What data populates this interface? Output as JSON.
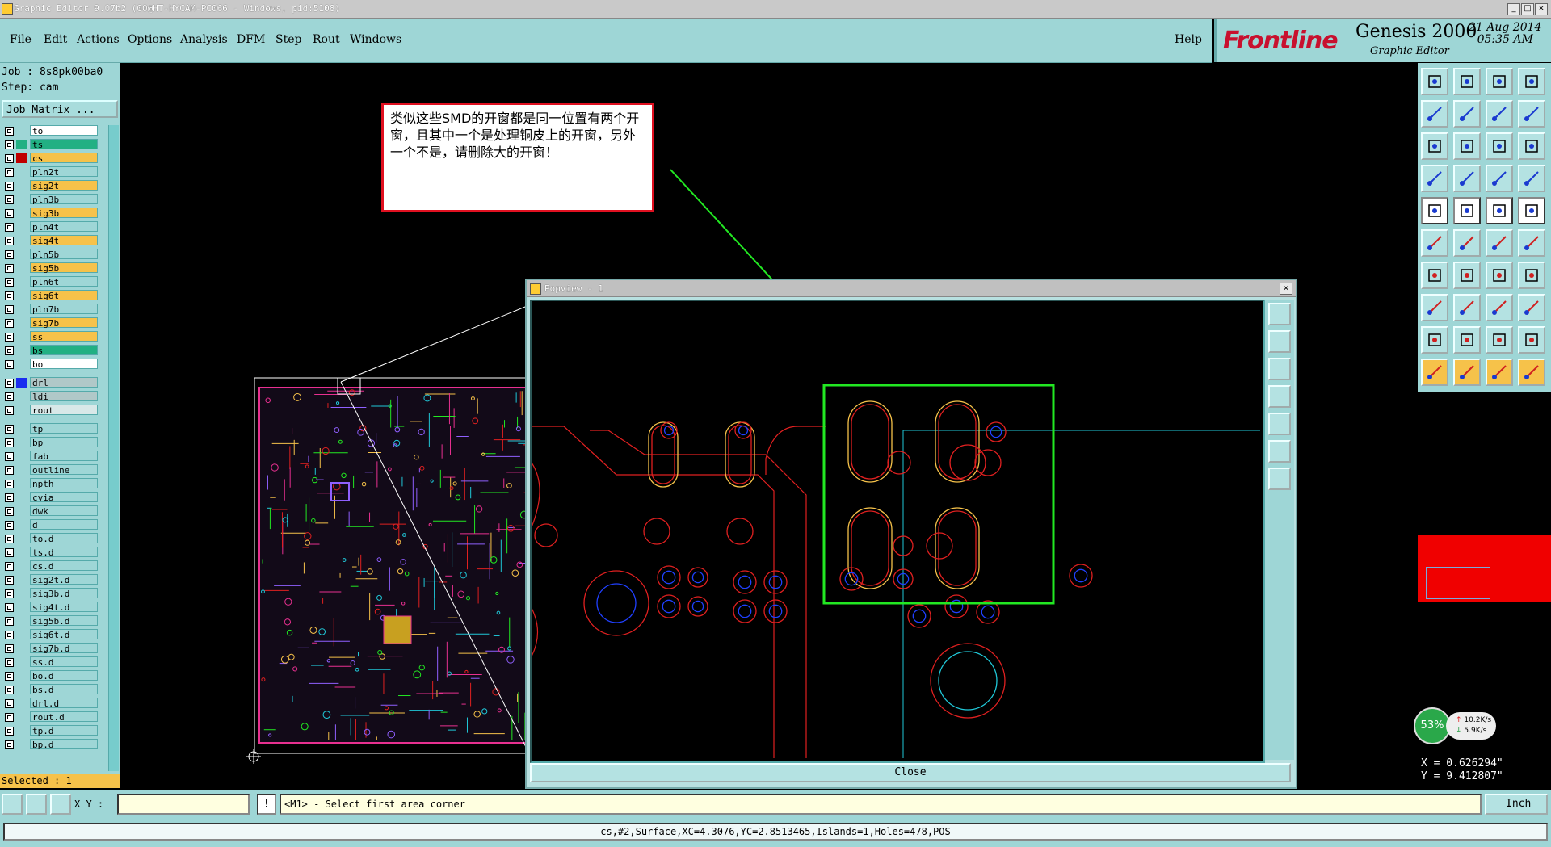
{
  "window": {
    "title": "Graphic Editor 9.07b2 (00@HT-HYCAM-PC066 - Windows, pid:5108)"
  },
  "menu": {
    "items": [
      "File",
      "Edit",
      "Actions",
      "Options",
      "Analysis",
      "DFM",
      "Step",
      "Rout",
      "Windows"
    ],
    "help": "Help"
  },
  "brand": {
    "company": "Frontline",
    "product": "Genesis 2000",
    "subtitle": "Graphic Editor",
    "date": "21 Aug 2014",
    "time": "05:35 AM"
  },
  "job": {
    "job_line": "Job : 8s8pk00ba0",
    "step_line": "Step: cam",
    "matrix_button": "Job Matrix ..."
  },
  "layers": [
    {
      "name": "to",
      "color": "#ffffff",
      "swatch": "#9ed6d6"
    },
    {
      "name": "ts",
      "color": "#22b083",
      "swatch": "#22b083"
    },
    {
      "name": "cs",
      "color": "#f6c24a",
      "swatch": "#c00000"
    },
    {
      "name": "pln2t",
      "color": "#9ed6d6",
      "swatch": "#9ed6d6"
    },
    {
      "name": "sig2t",
      "color": "#f6c24a",
      "swatch": "#9ed6d6"
    },
    {
      "name": "pln3b",
      "color": "#9ed6d6",
      "swatch": "#9ed6d6"
    },
    {
      "name": "sig3b",
      "color": "#f6c24a",
      "swatch": "#9ed6d6"
    },
    {
      "name": "pln4t",
      "color": "#9ed6d6",
      "swatch": "#9ed6d6"
    },
    {
      "name": "sig4t",
      "color": "#f6c24a",
      "swatch": "#9ed6d6"
    },
    {
      "name": "pln5b",
      "color": "#9ed6d6",
      "swatch": "#9ed6d6"
    },
    {
      "name": "sig5b",
      "color": "#f6c24a",
      "swatch": "#9ed6d6"
    },
    {
      "name": "pln6t",
      "color": "#9ed6d6",
      "swatch": "#9ed6d6"
    },
    {
      "name": "sig6t",
      "color": "#f6c24a",
      "swatch": "#9ed6d6"
    },
    {
      "name": "pln7b",
      "color": "#9ed6d6",
      "swatch": "#9ed6d6"
    },
    {
      "name": "sig7b",
      "color": "#f6c24a",
      "swatch": "#9ed6d6"
    },
    {
      "name": "ss",
      "color": "#f6c24a",
      "swatch": "#9ed6d6"
    },
    {
      "name": "bs",
      "color": "#22b083",
      "swatch": "#9ed6d6"
    },
    {
      "name": "bo",
      "color": "#ffffff",
      "swatch": "#9ed6d6"
    },
    {
      "name": "drl",
      "color": "#b0c8c8",
      "swatch": "#1a2cf0"
    },
    {
      "name": "ldi",
      "color": "#b0c8c8",
      "swatch": "#9ed6d6"
    },
    {
      "name": "rout",
      "color": "#d8e8e8",
      "swatch": "#9ed6d6"
    },
    {
      "name": "tp",
      "color": "#9ed6d6",
      "swatch": "#9ed6d6"
    },
    {
      "name": "bp",
      "color": "#9ed6d6",
      "swatch": "#9ed6d6"
    },
    {
      "name": "fab",
      "color": "#9ed6d6",
      "swatch": "#9ed6d6"
    },
    {
      "name": "outline",
      "color": "#9ed6d6",
      "swatch": "#9ed6d6"
    },
    {
      "name": "npth",
      "color": "#9ed6d6",
      "swatch": "#9ed6d6"
    },
    {
      "name": "cvia",
      "color": "#9ed6d6",
      "swatch": "#9ed6d6"
    },
    {
      "name": "dwk",
      "color": "#9ed6d6",
      "swatch": "#9ed6d6"
    },
    {
      "name": "d",
      "color": "#9ed6d6",
      "swatch": "#9ed6d6"
    },
    {
      "name": "to.d",
      "color": "#9ed6d6",
      "swatch": "#9ed6d6"
    },
    {
      "name": "ts.d",
      "color": "#9ed6d6",
      "swatch": "#9ed6d6"
    },
    {
      "name": "cs.d",
      "color": "#9ed6d6",
      "swatch": "#9ed6d6"
    },
    {
      "name": "sig2t.d",
      "color": "#9ed6d6",
      "swatch": "#9ed6d6"
    },
    {
      "name": "sig3b.d",
      "color": "#9ed6d6",
      "swatch": "#9ed6d6"
    },
    {
      "name": "sig4t.d",
      "color": "#9ed6d6",
      "swatch": "#9ed6d6"
    },
    {
      "name": "sig5b.d",
      "color": "#9ed6d6",
      "swatch": "#9ed6d6"
    },
    {
      "name": "sig6t.d",
      "color": "#9ed6d6",
      "swatch": "#9ed6d6"
    },
    {
      "name": "sig7b.d",
      "color": "#9ed6d6",
      "swatch": "#9ed6d6"
    },
    {
      "name": "ss.d",
      "color": "#9ed6d6",
      "swatch": "#9ed6d6"
    },
    {
      "name": "bo.d",
      "color": "#9ed6d6",
      "swatch": "#9ed6d6"
    },
    {
      "name": "bs.d",
      "color": "#9ed6d6",
      "swatch": "#9ed6d6"
    },
    {
      "name": "drl.d",
      "color": "#9ed6d6",
      "swatch": "#9ed6d6"
    },
    {
      "name": "rout.d",
      "color": "#9ed6d6",
      "swatch": "#9ed6d6"
    },
    {
      "name": "tp.d",
      "color": "#9ed6d6",
      "swatch": "#9ed6d6"
    },
    {
      "name": "bp.d",
      "color": "#9ed6d6",
      "swatch": "#9ed6d6"
    }
  ],
  "selected": "Selected : 1",
  "annotation": {
    "text": "类似这些SMD的开窗都是同一位置有两个开窗，且其中一个是处理铜皮上的开窗，另外一个不是，请删除大的开窗！"
  },
  "popview": {
    "title": "Popview - 1",
    "close_label": "Close"
  },
  "netmeter": {
    "percent": "53%",
    "up": "10.2K/s",
    "down": "5.9K/s"
  },
  "coords": {
    "x": "X = 0.626294\"",
    "y": "Y = 9.412807\""
  },
  "bottom": {
    "xy_label": "X Y :",
    "xy_value": "",
    "message": "<M1> - Select first area corner",
    "unit": "Inch"
  },
  "status": {
    "text": "cs,#2,Surface,XC=4.3076,YC=2.8513465,Islands=1,Holes=478,POS"
  },
  "colors": {
    "panel": "#9ed6d6",
    "accent_orange": "#f6c24a",
    "brand_red": "#c8102e"
  }
}
